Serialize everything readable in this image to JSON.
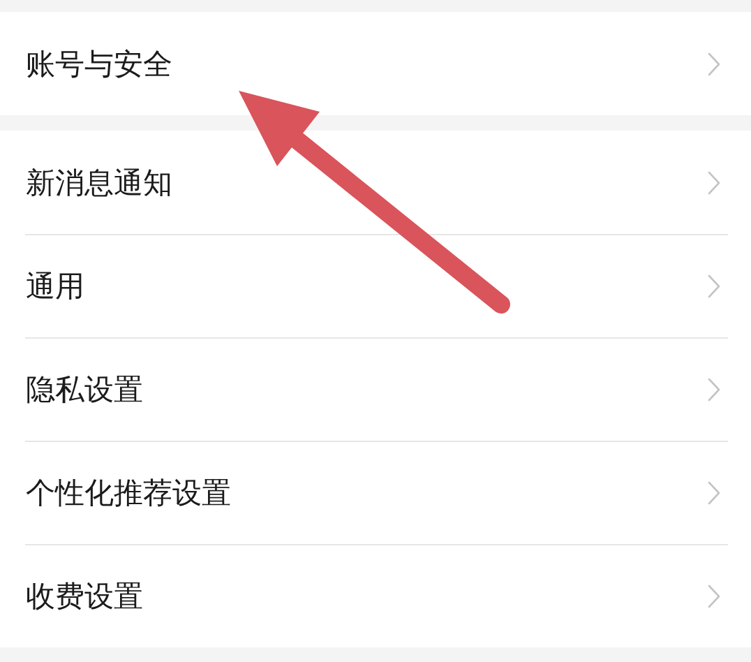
{
  "groups": [
    {
      "items": [
        {
          "label": "账号与安全"
        }
      ]
    },
    {
      "items": [
        {
          "label": "新消息通知"
        },
        {
          "label": "通用"
        },
        {
          "label": "隐私设置"
        },
        {
          "label": "个性化推荐设置"
        },
        {
          "label": "收费设置"
        }
      ]
    }
  ]
}
